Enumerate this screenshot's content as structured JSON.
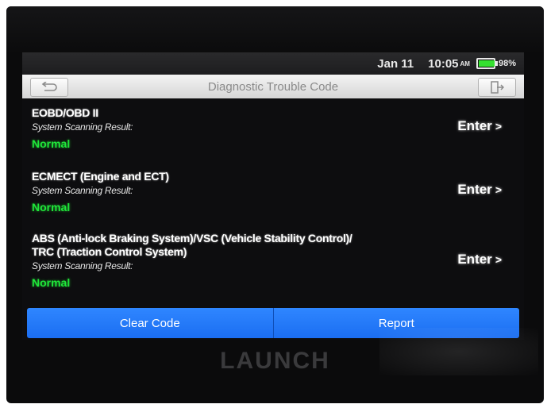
{
  "status": {
    "date": "Jan 11",
    "time": "10:05",
    "ampm": "AM",
    "battery_level": 0.98,
    "battery_text": "98%",
    "battery_color": "#35e030"
  },
  "header": {
    "title": "Diagnostic Trouble Code",
    "back_icon": "back-arrow-icon",
    "exit_icon": "exit-icon"
  },
  "systems": [
    {
      "name_line1": "EOBD/OBD II",
      "name_line2": "",
      "scan_label": "System Scanning Result:",
      "result": "Normal",
      "enter_label": "Enter",
      "enter_arrow": ">"
    },
    {
      "name_line1": "ECMECT (Engine and ECT)",
      "name_line2": "",
      "scan_label": "System Scanning Result:",
      "result": "Normal",
      "enter_label": "Enter",
      "enter_arrow": ">"
    },
    {
      "name_line1": "ABS (Anti-lock Braking System)/VSC (Vehicle Stability Control)/",
      "name_line2": "TRC (Traction Control System)",
      "scan_label": "System Scanning Result:",
      "result": "Normal",
      "enter_label": "Enter",
      "enter_arrow": ">"
    }
  ],
  "footer": {
    "clear_code": "Clear Code",
    "report": "Report",
    "accent": "#1f75f7"
  },
  "brand": "LAUNCH",
  "result_color": "#1fe63a"
}
